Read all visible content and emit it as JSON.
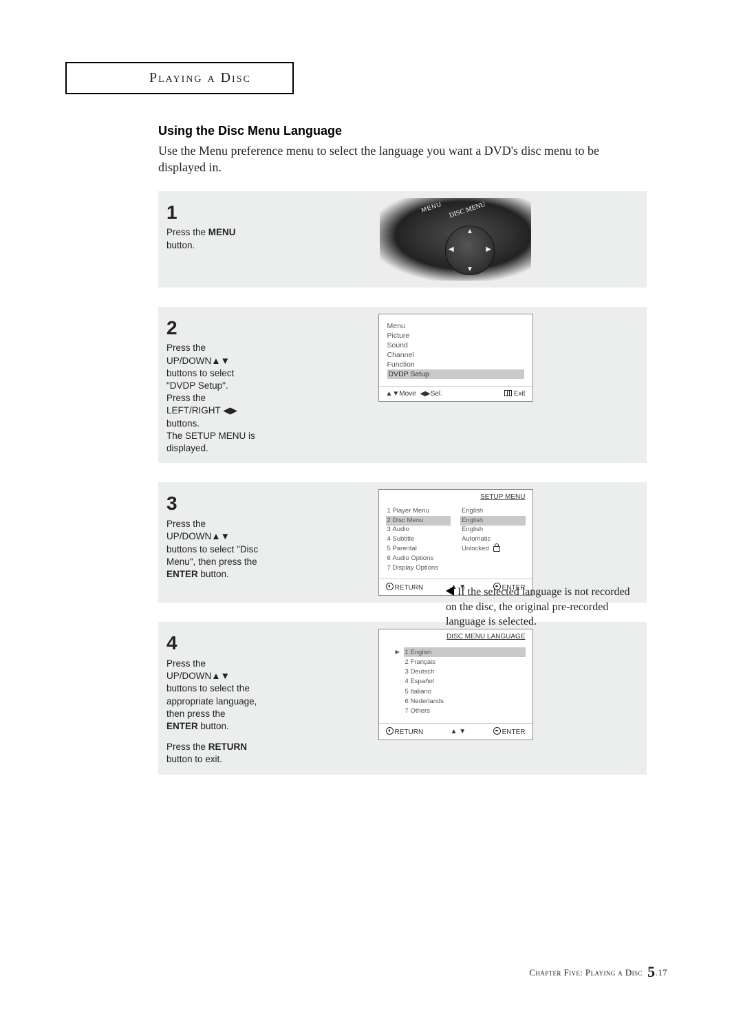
{
  "section_tab": "Playing a Disc",
  "heading": "Using the Disc Menu Language",
  "intro": "Use the Menu preference menu to select the language you want a DVD's disc menu to be displayed in.",
  "steps": {
    "s1": {
      "num": "1",
      "text_before": "Press the ",
      "bold": "MENU",
      "text_after": " button."
    },
    "s2": {
      "num": "2",
      "l1": "Press the UP/DOWN▲▼ buttons to select \"DVDP Setup\".",
      "l2": "Press the LEFT/RIGHT ◀▶ buttons.",
      "l3": "The SETUP MENU is displayed."
    },
    "s3": {
      "num": "3",
      "text_before": "Press the UP/DOWN▲▼ buttons to select \"Disc Menu\", then press the ",
      "bold": "ENTER",
      "text_after": " button."
    },
    "s4": {
      "num": "4",
      "l1_before": "Press the UP/DOWN▲▼ buttons to select the appropriate language, then press the ",
      "l1_bold": "ENTER",
      "l1_after": " button.",
      "l2_before": "Press the ",
      "l2_bold": "RETURN",
      "l2_after": " button to exit."
    }
  },
  "osd2": {
    "items": [
      "Menu",
      "Picture",
      "Sound",
      "Channel",
      "Function"
    ],
    "highlight": "DVDP Setup",
    "footer_move": "▲▼Move",
    "footer_sel": "◀▶Sel.",
    "footer_exit": "Exit"
  },
  "osd3": {
    "title": "SETUP  MENU",
    "rows": [
      {
        "n": "1",
        "label": "Player Menu",
        "val": "English"
      },
      {
        "n": "2",
        "label": "Disc Menu",
        "val": "English",
        "hl": true
      },
      {
        "n": "3",
        "label": "Audio",
        "val": "English"
      },
      {
        "n": "4",
        "label": "Subtitle",
        "val": "Automatic"
      },
      {
        "n": "5",
        "label": "Parental",
        "val": "Unlocked",
        "lock": true
      },
      {
        "n": "6",
        "label": "Audio Options",
        "val": ""
      },
      {
        "n": "7",
        "label": "Display Options",
        "val": ""
      }
    ],
    "footer_return": "RETURN",
    "footer_arrows": "▲ ▼",
    "footer_enter": "ENTER"
  },
  "osd4": {
    "title": "DISC MENU LANGUAGE",
    "rows": [
      {
        "n": "1",
        "label": "English",
        "hl": true
      },
      {
        "n": "2",
        "label": "Français"
      },
      {
        "n": "3",
        "label": "Deutsch"
      },
      {
        "n": "4",
        "label": "Español"
      },
      {
        "n": "5",
        "label": "Italiano"
      },
      {
        "n": "6",
        "label": "Nederlands"
      },
      {
        "n": "7",
        "label": "Others"
      }
    ],
    "footer_return": "RETURN",
    "footer_arrows": "▲ ▼",
    "footer_enter": "ENTER"
  },
  "remote_labels": {
    "menu": "MENU",
    "disc_menu": "DISC MENU"
  },
  "note": "If the selected language is not recorded on the disc, the original pre-recorded language is selected.",
  "footer": {
    "chapter": "Chapter Five: Playing a Disc",
    "page_major": "5",
    "page_minor": ".17"
  }
}
